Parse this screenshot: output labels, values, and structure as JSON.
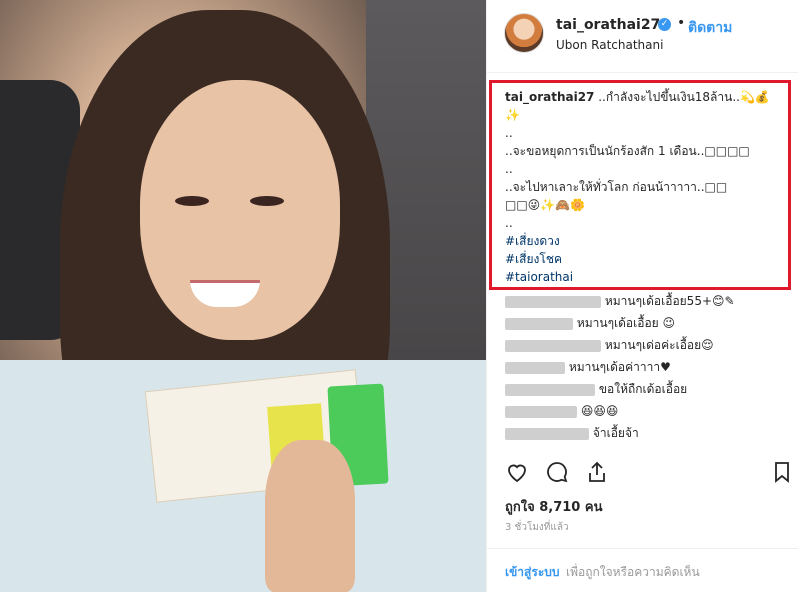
{
  "post": {
    "username": "tai_orathai27",
    "verified_mark": "✓",
    "separator": "•",
    "follow_label": "ติดตาม",
    "location": "Ubon Ratchathani"
  },
  "caption": {
    "username": "tai_orathai27",
    "line1": " ..กำลังจะไปขึ้นเงิน18ล้าน..💫💰",
    "line2": "✨",
    "line3": "..",
    "line4": "..จะขอหยุดการเป็นนักร้องสัก 1 เดือน..□□□□",
    "line5": "..",
    "line6": "..จะไปหาเลาะให้ทั่วโลก ก่อนน้าาาาา..□□",
    "line7": "□□😜✨🙈🌼",
    "line8": "..",
    "hashtags": [
      "#เสี่ยงดวง",
      "#เสี่ยงโชค",
      "#taiorathai"
    ]
  },
  "comments": [
    {
      "text": "หมานๆเด้อเอื้อย55+😊✎"
    },
    {
      "text": "หมานๆเด้อเอื้อย 😉"
    },
    {
      "text": "หมานๆเด่อค่ะเอื้อย😌"
    },
    {
      "text": "หมานๆเด้อค่าาาา♥"
    },
    {
      "text": "ขอให้ถืกเด้อเอื้อย"
    },
    {
      "text": "😆😆😆"
    },
    {
      "text": "จ้าเอื้ยจ้า"
    }
  ],
  "actions": {
    "like_icon": "heart-icon",
    "comment_icon": "comment-icon",
    "share_icon": "share-icon",
    "save_icon": "bookmark-icon"
  },
  "likes": "ถูกใจ 8,710 คน",
  "timestamp": "3 ชั่วโมงที่แล้ว",
  "login": {
    "link": "เข้าสู่ระบบ",
    "text": "เพื่อถูกใจหรือความคิดเห็น"
  },
  "colors": {
    "link_blue": "#3897f0",
    "highlight_red": "#e0182b",
    "hashtag": "#003569"
  }
}
